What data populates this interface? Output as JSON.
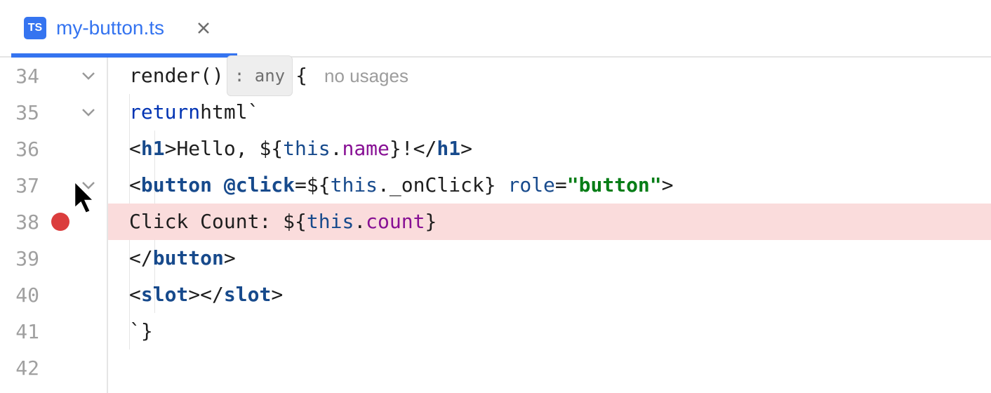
{
  "tab": {
    "filename": "my-button.ts",
    "file_icon_text": "TS"
  },
  "gutter": {
    "line_numbers": [
      "34",
      "35",
      "36",
      "37",
      "38",
      "39",
      "40",
      "41",
      "42"
    ],
    "fold_lines": [
      0,
      1,
      3
    ],
    "breakpoint_line_index": 4
  },
  "hints": {
    "return_type": ": any",
    "usages": "no usages"
  },
  "code": {
    "l34": {
      "render": "render",
      "parens": "()",
      "brace": "{"
    },
    "l35": {
      "ret": "return",
      "html": "html",
      "tick": "`"
    },
    "l36": {
      "open": "<",
      "tag": "h1",
      "gt": ">",
      "hello": "Hello, ",
      "dopen": "${",
      "this": "this",
      "dot": ".",
      "prop": "name",
      "dclose": "}",
      "bang": "!",
      "close_open": "</",
      "close_gt": ">"
    },
    "l37": {
      "open": "<",
      "tag": "button",
      "sp": " ",
      "event": "@click",
      "eq": "=",
      "dopen": "${",
      "this": "this",
      "dot": ".",
      "method": "_onClick",
      "dclose": "}",
      "sp2": " ",
      "attr": "role",
      "eq2": "=",
      "val": "\"button\"",
      "gt": ">"
    },
    "l38": {
      "text": "Click Count: ",
      "dopen": "${",
      "this": "this",
      "dot": ".",
      "prop": "count",
      "dclose": "}"
    },
    "l39": {
      "close_open": "</",
      "tag": "button",
      "gt": ">"
    },
    "l40": {
      "open": "<",
      "tag": "slot",
      "gt": ">",
      "close_open": "</",
      "gt2": ">"
    },
    "l41": {
      "tick": "`",
      "brace": "}"
    }
  }
}
